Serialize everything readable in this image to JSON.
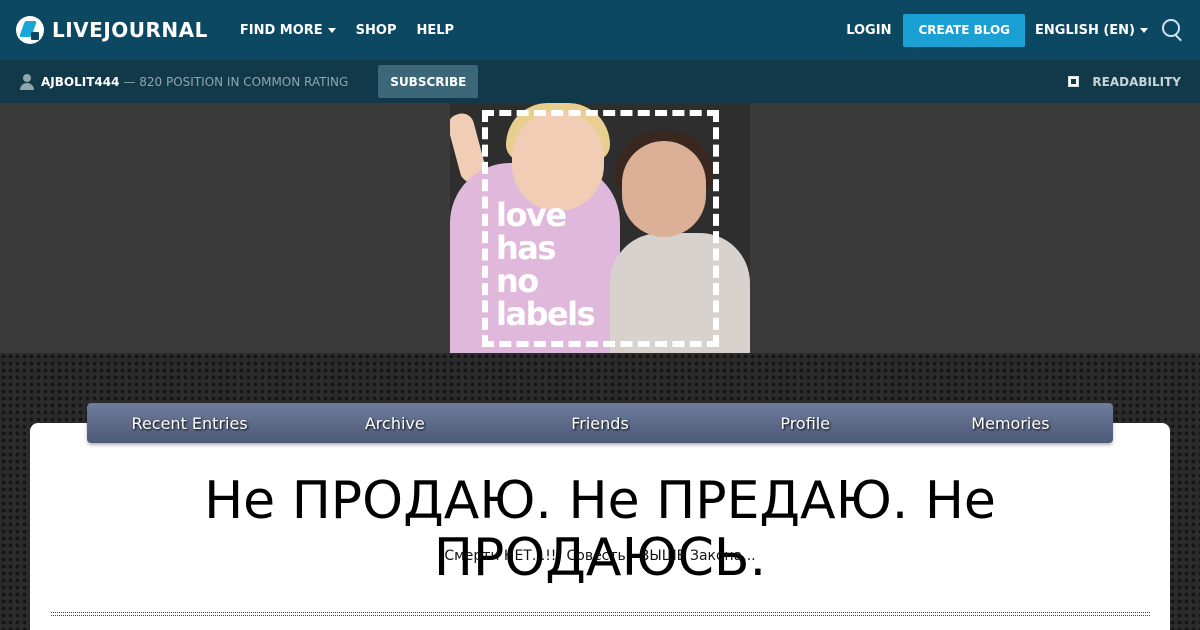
{
  "topbar": {
    "logo_text": "LIVEJOURNAL",
    "nav": [
      {
        "label": "FIND MORE",
        "dropdown": true
      },
      {
        "label": "SHOP",
        "dropdown": false
      },
      {
        "label": "HELP",
        "dropdown": false
      }
    ],
    "login_label": "LOGIN",
    "create_blog_label": "CREATE BLOG",
    "language_label": "ENGLISH (EN)"
  },
  "userbar": {
    "username": "AJBOLIT444",
    "rating_text": "— 820 POSITION IN COMMON RATING",
    "subscribe_label": "SUBSCRIBE",
    "readability_label": "READABILITY"
  },
  "banner": {
    "text_lines": [
      "love",
      "has",
      "no",
      "labels"
    ]
  },
  "tabs": [
    {
      "label": "Recent Entries"
    },
    {
      "label": "Archive"
    },
    {
      "label": "Friends"
    },
    {
      "label": "Profile"
    },
    {
      "label": "Memories"
    }
  ],
  "blog": {
    "title": "Не ПРОДАЮ. Не ПРЕДАЮ. Не ПРОДАЮСЬ.",
    "subtitle": "Смерти НЕТ...!!! Совесть - ВЫШЕ Закона..."
  },
  "colors": {
    "topbar_bg": "#0c4862",
    "userbar_bg": "#123949",
    "accent": "#1aa0d3",
    "tab_bar": "#5a6886"
  },
  "icons": [
    "livejournal-logo-icon",
    "chevron-down-icon",
    "search-icon",
    "user-icon",
    "checkbox-icon"
  ]
}
